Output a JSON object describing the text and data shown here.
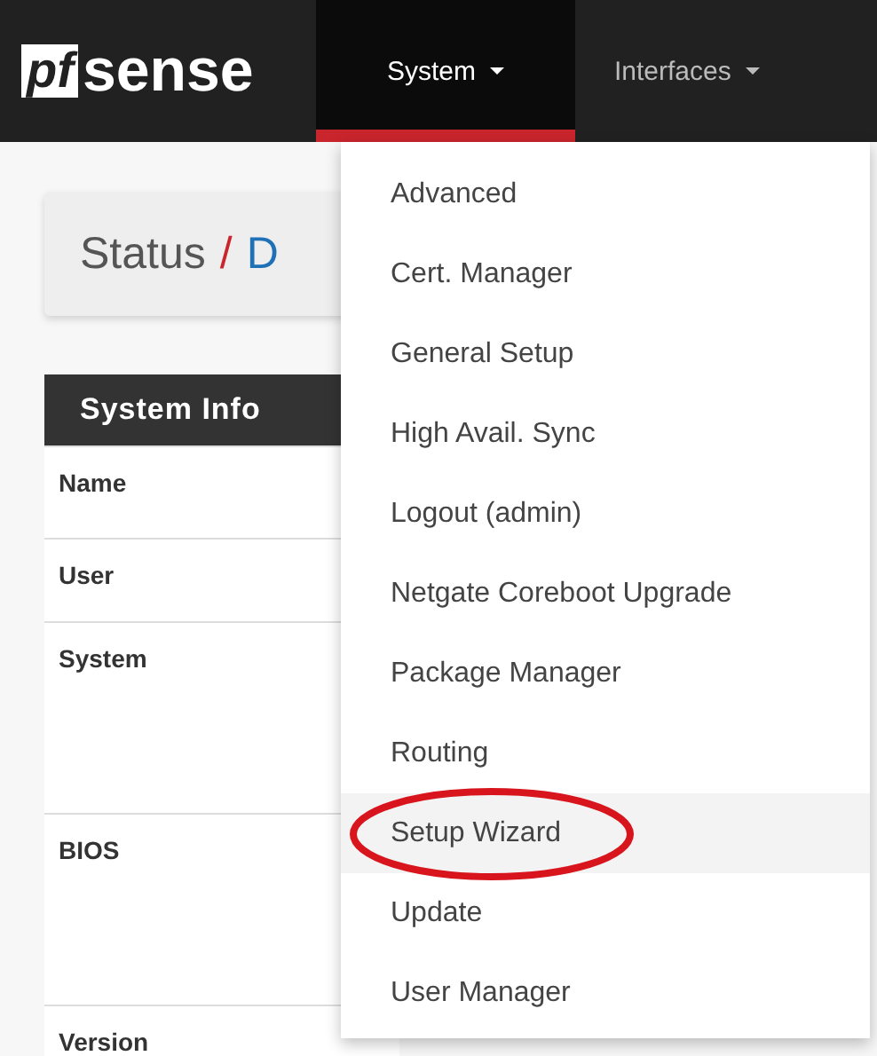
{
  "navbar": {
    "logo": {
      "prefix": "pf",
      "name": "sense"
    },
    "menus": [
      {
        "label": "System",
        "selected": true
      },
      {
        "label": "Interfaces",
        "selected": false
      }
    ]
  },
  "breadcrumb": [
    "Status",
    "/",
    "D"
  ],
  "system_info": {
    "title": "System Info",
    "rows": [
      "Name",
      "User",
      "System",
      "BIOS",
      "Version"
    ]
  },
  "dropdown": {
    "items": [
      {
        "label": "Advanced",
        "selected": false,
        "circled": false
      },
      {
        "label": "Cert. Manager",
        "selected": false,
        "circled": false
      },
      {
        "label": "General Setup",
        "selected": false,
        "circled": false
      },
      {
        "label": "High Avail. Sync",
        "selected": false,
        "circled": false
      },
      {
        "label": "Logout (admin)",
        "selected": false,
        "circled": false
      },
      {
        "label": "Netgate Coreboot Upgrade",
        "selected": false,
        "circled": false
      },
      {
        "label": "Package Manager",
        "selected": false,
        "circled": false
      },
      {
        "label": "Routing",
        "selected": false,
        "circled": false
      },
      {
        "label": "Setup Wizard",
        "selected": true,
        "circled": true
      },
      {
        "label": "Update",
        "selected": false,
        "circled": false
      },
      {
        "label": "User Manager",
        "selected": false,
        "circled": false
      }
    ]
  }
}
